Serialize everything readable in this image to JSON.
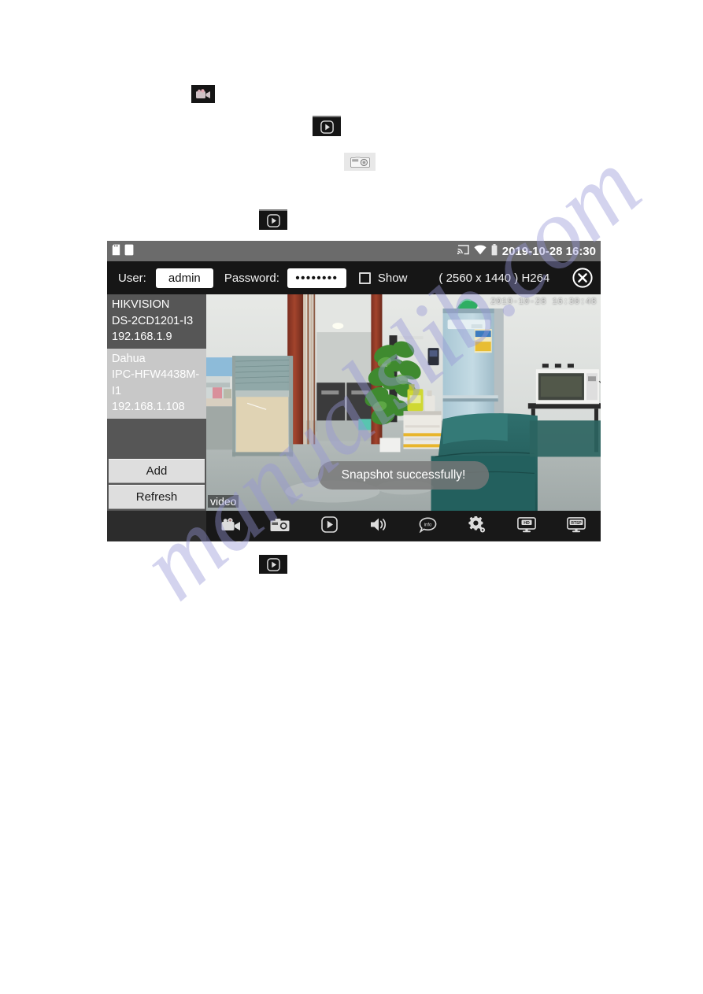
{
  "document": {
    "watermark": "manualslib.com",
    "inline_icons": [
      {
        "name": "record-video-icon",
        "label": "record"
      },
      {
        "name": "play-icon",
        "label": "play"
      },
      {
        "name": "snapshot-camera-icon",
        "label": "snapshot"
      },
      {
        "name": "play-icon",
        "label": "play"
      }
    ]
  },
  "app": {
    "status_bar": {
      "icons": [
        "sd-card-icon",
        "file-icon",
        "cast-icon",
        "wifi-icon",
        "battery-icon"
      ],
      "clock": "2019-10-28 16:30"
    },
    "login_bar": {
      "user_label": "User:",
      "user_value": "admin",
      "user_placeholder": "admin",
      "password_label": "Password:",
      "password_value": "••••••••",
      "show_label": "Show",
      "show_checked": false,
      "resolution": "( 2560 x 1440 ) H264",
      "close_label": "×"
    },
    "sidebar": {
      "devices": [
        {
          "brand": "HIKVISION",
          "model": "DS-2CD1201-I3",
          "ip": "192.168.1.9",
          "selected": false
        },
        {
          "brand": "Dahua",
          "model": "IPC-HFW4438M-I1",
          "ip": "192.168.1.108",
          "selected": true
        }
      ],
      "add_label": "Add",
      "refresh_label": "Refresh"
    },
    "video": {
      "osd_timestamp": "2019-10-28 16:30:48",
      "stream_label": "video",
      "toast": "Snapshot successfully!"
    },
    "toolbar": [
      {
        "name": "record-video-icon",
        "label": "Record"
      },
      {
        "name": "snapshot-camera-icon",
        "label": "Snapshot"
      },
      {
        "name": "play-icon",
        "label": "Play"
      },
      {
        "name": "speaker-icon",
        "label": "Audio"
      },
      {
        "name": "info-bubble-icon",
        "label": "Info"
      },
      {
        "name": "gear-icon",
        "label": "Settings"
      },
      {
        "name": "hd-monitor-icon",
        "label": "HD"
      },
      {
        "name": "rtsp-monitor-icon",
        "label": "RTSP"
      }
    ]
  },
  "colors": {
    "status_bar_bg": "#6b6b6b",
    "login_bar_bg": "#161616",
    "sidebar_bg": "#565656",
    "selected_device_bg": "#c8c8c8",
    "toolbar_bg": "#181818",
    "button_bg": "#dedede",
    "watermark": "#9696d7"
  }
}
